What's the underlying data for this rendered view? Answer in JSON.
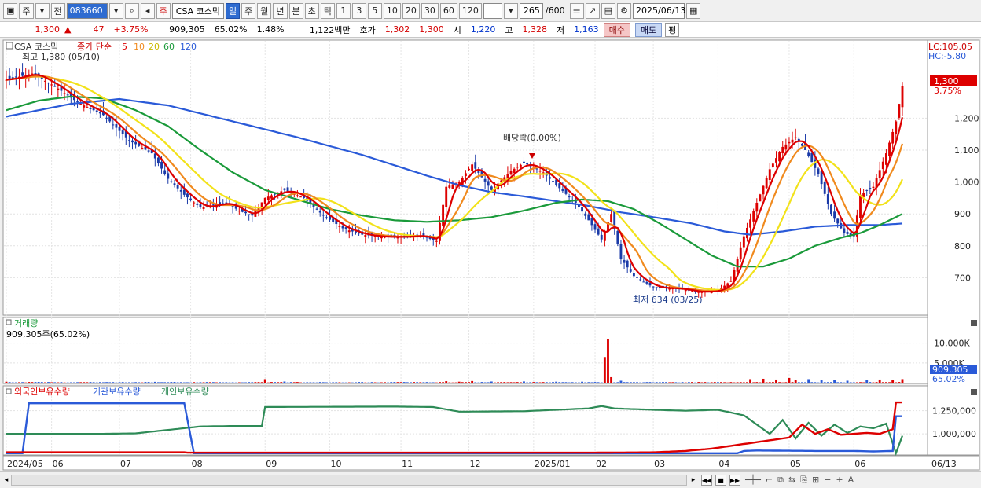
{
  "toolbar": {
    "period_selector": "주",
    "code_type": "전",
    "stock_code": "083660",
    "market_tag": "주",
    "stock_name": "CSA 코스믹",
    "period_buttons": [
      "일",
      "주",
      "월",
      "년",
      "분",
      "초",
      "틱"
    ],
    "active_period": "일",
    "interval_buttons": [
      "1",
      "3",
      "5",
      "10",
      "20",
      "30",
      "60",
      "120"
    ],
    "bar_count": "265",
    "bar_max": "/600",
    "date": "2025/06/13"
  },
  "infobar": {
    "price": "1,300",
    "change": "47",
    "change_pct": "+3.75%",
    "volume": "909,305",
    "volume_ratio": "65.02%",
    "turnover_pct": "1.48%",
    "amount": "1,122백만",
    "quote_label": "호가",
    "quote_1": "1,302",
    "quote_2": "1,300",
    "open_label": "시",
    "open": "1,220",
    "high_label": "고",
    "high": "1,328",
    "low_label": "저",
    "low": "1,163",
    "buy": "매수",
    "sell": "매도",
    "eval": "평"
  },
  "legend": {
    "name": "CSA 코스믹",
    "ma_label": "종가 단순",
    "ma_periods": [
      "5",
      "10",
      "20",
      "60",
      "120"
    ],
    "ma_colors": [
      "#dd0000",
      "#f08a1e",
      "#f2e21a",
      "#1a9a3a",
      "#2a5ad8"
    ],
    "high_note": "최고 1,380 (05/10)",
    "low_note": "최저 634 (03/25)",
    "dividend_note": "배당락(0.00%)",
    "lc_label": "LC:105.05",
    "hc_label": "HC:-5.80",
    "last_price": "1,300",
    "last_pct": "3.75%"
  },
  "volume_panel": {
    "title": "거래량",
    "current": "909,305주(65.02%)",
    "last_value": "909,305",
    "last_pct": "65.02%"
  },
  "holdings_panel": {
    "legend": [
      "외국인보유수량",
      "기관보유수량",
      "개인보유수량"
    ],
    "colors": [
      "#dd0000",
      "#2a5ad8",
      "#2e8b57"
    ]
  },
  "chart_data": {
    "type": "line",
    "price_axis": {
      "ticks": [
        700,
        800,
        900,
        1000,
        1100,
        1200
      ],
      "ylim": [
        600,
        1430
      ]
    },
    "volume_axis": {
      "tick_labels": [
        "5,000K",
        "10,000K"
      ],
      "ticks": [
        5000,
        10000
      ],
      "ylim": [
        0,
        13500
      ]
    },
    "holdings_axis": {
      "tick_labels": [
        "1,000,000",
        "1,250,000"
      ],
      "ticks": [
        1000000,
        1250000
      ],
      "ylim": [
        780000,
        1400000
      ]
    },
    "x_labels": [
      "2024/05",
      "06",
      "07",
      "08",
      "09",
      "10",
      "11",
      "12",
      "2025/01",
      "02",
      "03",
      "04",
      "05",
      "06",
      "06/13"
    ],
    "x_label_idx": [
      0,
      14,
      35,
      57,
      80,
      100,
      122,
      143,
      163,
      182,
      200,
      220,
      242,
      262,
      290
    ],
    "n_bars": 278,
    "close_anchors": [
      [
        0,
        1320
      ],
      [
        8,
        1340
      ],
      [
        15,
        1300
      ],
      [
        22,
        1250
      ],
      [
        30,
        1210
      ],
      [
        38,
        1130
      ],
      [
        45,
        1090
      ],
      [
        50,
        1010
      ],
      [
        55,
        960
      ],
      [
        60,
        920
      ],
      [
        68,
        935
      ],
      [
        72,
        910
      ],
      [
        76,
        895
      ],
      [
        80,
        950
      ],
      [
        86,
        975
      ],
      [
        92,
        950
      ],
      [
        98,
        895
      ],
      [
        104,
        855
      ],
      [
        110,
        835
      ],
      [
        116,
        828
      ],
      [
        122,
        828
      ],
      [
        128,
        832
      ],
      [
        133,
        815
      ],
      [
        136,
        985
      ],
      [
        140,
        1000
      ],
      [
        144,
        1055
      ],
      [
        150,
        975
      ],
      [
        156,
        1035
      ],
      [
        160,
        1060
      ],
      [
        166,
        1030
      ],
      [
        170,
        990
      ],
      [
        176,
        935
      ],
      [
        180,
        880
      ],
      [
        184,
        820
      ],
      [
        187,
        900
      ],
      [
        190,
        760
      ],
      [
        194,
        705
      ],
      [
        200,
        670
      ],
      [
        208,
        665
      ],
      [
        214,
        655
      ],
      [
        220,
        660
      ],
      [
        224,
        690
      ],
      [
        228,
        830
      ],
      [
        232,
        935
      ],
      [
        236,
        1040
      ],
      [
        240,
        1110
      ],
      [
        244,
        1140
      ],
      [
        247,
        1100
      ],
      [
        251,
        1025
      ],
      [
        255,
        900
      ],
      [
        259,
        840
      ],
      [
        262,
        830
      ],
      [
        264,
        960
      ],
      [
        268,
        985
      ],
      [
        272,
        1090
      ],
      [
        275,
        1190
      ],
      [
        277,
        1300
      ]
    ],
    "ma60_anchors": [
      [
        0,
        1225
      ],
      [
        10,
        1255
      ],
      [
        20,
        1268
      ],
      [
        30,
        1262
      ],
      [
        40,
        1225
      ],
      [
        50,
        1175
      ],
      [
        60,
        1100
      ],
      [
        70,
        1030
      ],
      [
        80,
        975
      ],
      [
        90,
        945
      ],
      [
        100,
        915
      ],
      [
        110,
        895
      ],
      [
        120,
        880
      ],
      [
        130,
        875
      ],
      [
        140,
        880
      ],
      [
        150,
        890
      ],
      [
        160,
        910
      ],
      [
        170,
        935
      ],
      [
        178,
        945
      ],
      [
        186,
        940
      ],
      [
        194,
        915
      ],
      [
        202,
        870
      ],
      [
        210,
        820
      ],
      [
        218,
        770
      ],
      [
        226,
        735
      ],
      [
        234,
        735
      ],
      [
        242,
        760
      ],
      [
        250,
        800
      ],
      [
        258,
        825
      ],
      [
        264,
        840
      ],
      [
        270,
        865
      ],
      [
        277,
        900
      ]
    ],
    "ma120_anchors": [
      [
        0,
        1205
      ],
      [
        20,
        1245
      ],
      [
        35,
        1260
      ],
      [
        50,
        1240
      ],
      [
        70,
        1190
      ],
      [
        90,
        1140
      ],
      [
        110,
        1085
      ],
      [
        130,
        1020
      ],
      [
        140,
        990
      ],
      [
        150,
        968
      ],
      [
        160,
        955
      ],
      [
        170,
        940
      ],
      [
        180,
        925
      ],
      [
        190,
        905
      ],
      [
        200,
        890
      ],
      [
        212,
        870
      ],
      [
        222,
        845
      ],
      [
        230,
        835
      ],
      [
        240,
        845
      ],
      [
        250,
        860
      ],
      [
        260,
        865
      ],
      [
        270,
        865
      ],
      [
        277,
        870
      ]
    ],
    "volume_spikes": [
      [
        0,
        250
      ],
      [
        10,
        200
      ],
      [
        46,
        220
      ],
      [
        52,
        190
      ],
      [
        80,
        900
      ],
      [
        86,
        300
      ],
      [
        120,
        180
      ],
      [
        130,
        160
      ],
      [
        136,
        380
      ],
      [
        140,
        250
      ],
      [
        144,
        420
      ],
      [
        150,
        300
      ],
      [
        160,
        320
      ],
      [
        170,
        260
      ],
      [
        178,
        250
      ],
      [
        185,
        6500
      ],
      [
        186,
        11000
      ],
      [
        187,
        1400
      ],
      [
        190,
        500
      ],
      [
        230,
        900
      ],
      [
        234,
        1000
      ],
      [
        238,
        800
      ],
      [
        242,
        1200
      ],
      [
        244,
        700
      ],
      [
        248,
        900
      ],
      [
        252,
        700
      ],
      [
        256,
        600
      ],
      [
        260,
        500
      ],
      [
        266,
        600
      ],
      [
        270,
        800
      ],
      [
        274,
        700
      ],
      [
        277,
        909
      ]
    ],
    "foreign_anchors": [
      [
        0,
        800000
      ],
      [
        30,
        800000
      ],
      [
        55,
        800000
      ],
      [
        56,
        796000
      ],
      [
        100,
        796000
      ],
      [
        180,
        796000
      ],
      [
        200,
        800000
      ],
      [
        210,
        815000
      ],
      [
        218,
        840000
      ],
      [
        228,
        890000
      ],
      [
        236,
        930000
      ],
      [
        242,
        960000
      ],
      [
        246,
        1100000
      ],
      [
        250,
        1000000
      ],
      [
        254,
        1050000
      ],
      [
        258,
        990000
      ],
      [
        262,
        1000000
      ],
      [
        266,
        1010000
      ],
      [
        270,
        1000000
      ],
      [
        274,
        1050000
      ],
      [
        275,
        1340000
      ],
      [
        277,
        1340000
      ]
    ],
    "institution_anchors": [
      [
        0,
        790000
      ],
      [
        5,
        790000
      ],
      [
        7,
        1330000
      ],
      [
        50,
        1330000
      ],
      [
        55,
        1330000
      ],
      [
        58,
        790000
      ],
      [
        200,
        790000
      ],
      [
        226,
        790000
      ],
      [
        228,
        815000
      ],
      [
        232,
        820000
      ],
      [
        250,
        815000
      ],
      [
        262,
        815000
      ],
      [
        268,
        810000
      ],
      [
        274,
        815000
      ],
      [
        275,
        1190000
      ],
      [
        277,
        1190000
      ]
    ],
    "individual_anchors": [
      [
        0,
        1000000
      ],
      [
        30,
        1000000
      ],
      [
        40,
        1005000
      ],
      [
        60,
        1080000
      ],
      [
        70,
        1085000
      ],
      [
        79,
        1085000
      ],
      [
        80,
        1290000
      ],
      [
        120,
        1295000
      ],
      [
        132,
        1290000
      ],
      [
        140,
        1240000
      ],
      [
        160,
        1245000
      ],
      [
        170,
        1260000
      ],
      [
        180,
        1275000
      ],
      [
        184,
        1300000
      ],
      [
        188,
        1275000
      ],
      [
        200,
        1260000
      ],
      [
        210,
        1250000
      ],
      [
        220,
        1260000
      ],
      [
        228,
        1200000
      ],
      [
        232,
        1100000
      ],
      [
        236,
        1000000
      ],
      [
        240,
        1150000
      ],
      [
        244,
        950000
      ],
      [
        248,
        1120000
      ],
      [
        252,
        980000
      ],
      [
        256,
        1100000
      ],
      [
        260,
        1010000
      ],
      [
        264,
        1080000
      ],
      [
        268,
        1060000
      ],
      [
        272,
        1110000
      ],
      [
        275,
        790000
      ],
      [
        277,
        980000
      ]
    ]
  }
}
